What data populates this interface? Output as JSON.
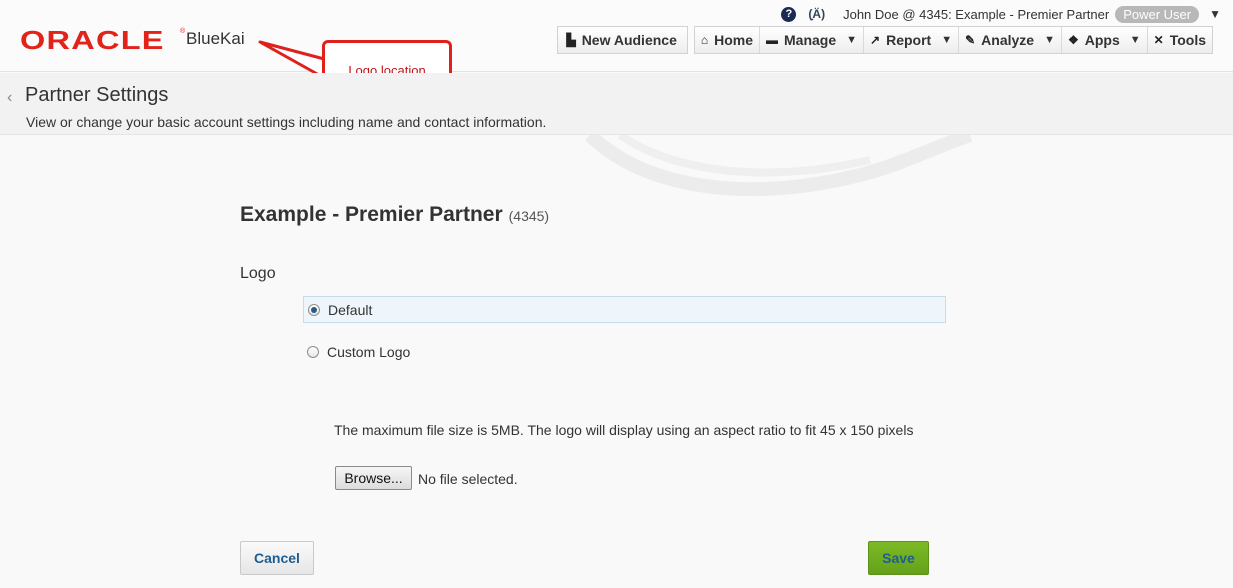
{
  "brand": {
    "oracle": "ORACLE",
    "trademark": "®",
    "product": "BlueKai",
    "oracle_color": "#e2231a"
  },
  "user_bar": {
    "help_icon": "help-circle-icon",
    "beacon_icon": "antenna-icon",
    "user_text": "John Doe @ 4345: Example - Premier Partner",
    "role_badge": "Power User"
  },
  "nav": {
    "new_audience": "New Audience",
    "items": [
      {
        "label": "Home",
        "icon": "home-icon",
        "has_dropdown": false
      },
      {
        "label": "Manage",
        "icon": "folder-icon",
        "has_dropdown": true
      },
      {
        "label": "Report",
        "icon": "chart-icon",
        "has_dropdown": true
      },
      {
        "label": "Analyze",
        "icon": "pencil-icon",
        "has_dropdown": true
      },
      {
        "label": "Apps",
        "icon": "box-icon",
        "has_dropdown": true
      },
      {
        "label": "Tools",
        "icon": "tools-icon",
        "has_dropdown": false
      }
    ]
  },
  "annotation": {
    "callout_text": "Logo location",
    "callout_color": "#e0201b"
  },
  "page": {
    "title": "Partner Settings",
    "subtitle": "View or change your basic account settings including name and contact information."
  },
  "partner": {
    "name": "Example - Premier Partner",
    "id": "(4345)"
  },
  "logo_section": {
    "label": "Logo",
    "options": [
      {
        "label": "Default",
        "selected": true
      },
      {
        "label": "Custom Logo",
        "selected": false
      }
    ],
    "file_note": "The maximum file size is 5MB. The logo will display using an aspect ratio to fit 45 x 150 pixels",
    "browse_label": "Browse...",
    "file_status": "No file selected."
  },
  "actions": {
    "cancel": "Cancel",
    "save": "Save",
    "save_color": "#6fae20"
  }
}
